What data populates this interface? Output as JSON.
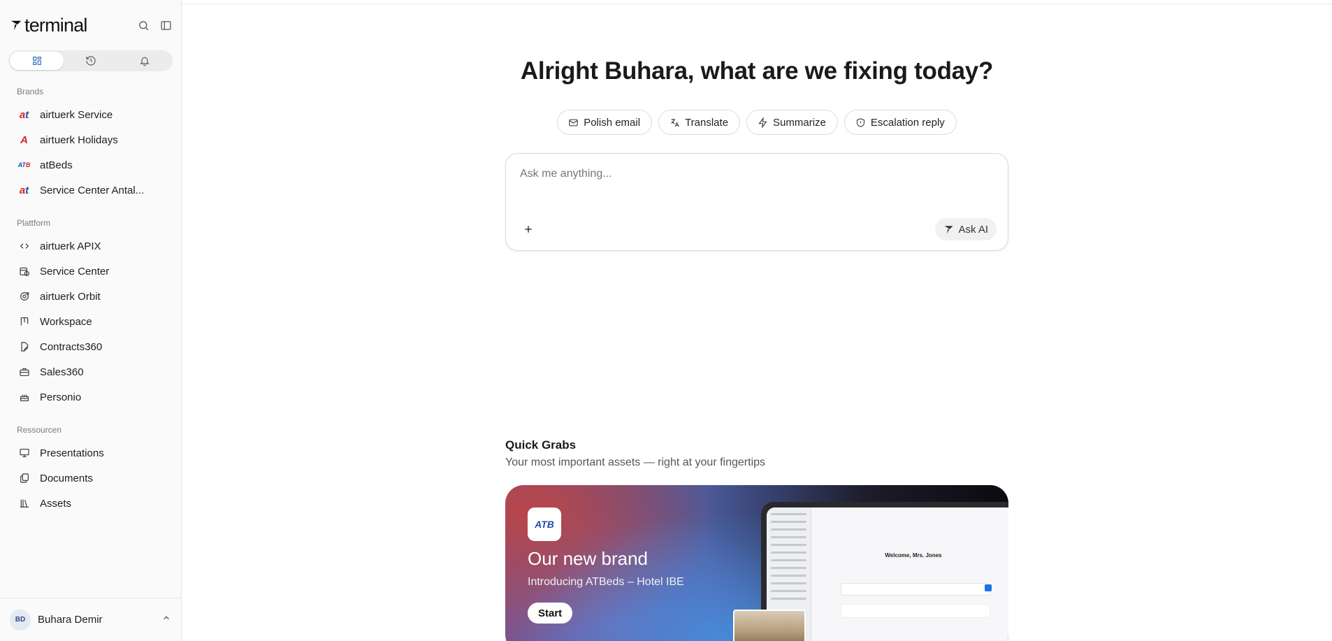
{
  "app": {
    "logo_text": "terminal",
    "search_icon": "search-icon",
    "sidebar_toggle_icon": "panel-left-icon"
  },
  "segmented": [
    {
      "icon": "grid-icon",
      "active": true
    },
    {
      "icon": "history-icon",
      "active": false
    },
    {
      "icon": "bell-icon",
      "active": false
    }
  ],
  "sidebar": {
    "sections": [
      {
        "label": "Brands",
        "items": [
          {
            "label": "airtuerk Service",
            "icon": "airtuerk-logo"
          },
          {
            "label": "airtuerk Holidays",
            "icon": "airtuerk-holidays-logo"
          },
          {
            "label": "atBeds",
            "icon": "atbeds-logo"
          },
          {
            "label": "Service Center Antal...",
            "icon": "airtuerk-logo"
          }
        ]
      },
      {
        "label": "Plattform",
        "items": [
          {
            "label": "airtuerk APIX",
            "icon": "code-icon"
          },
          {
            "label": "Service Center",
            "icon": "calendar-clock-icon"
          },
          {
            "label": "airtuerk Orbit",
            "icon": "orbit-icon"
          },
          {
            "label": "Workspace",
            "icon": "kanban-icon"
          },
          {
            "label": "Contracts360",
            "icon": "file-edit-icon"
          },
          {
            "label": "Sales360",
            "icon": "briefcase-icon"
          },
          {
            "label": "Personio",
            "icon": "cake-icon"
          }
        ]
      },
      {
        "label": "Ressourcen",
        "items": [
          {
            "label": "Presentations",
            "icon": "presentation-icon"
          },
          {
            "label": "Documents",
            "icon": "copy-file-icon"
          },
          {
            "label": "Assets",
            "icon": "library-icon"
          }
        ]
      }
    ]
  },
  "user": {
    "initials": "BD",
    "name": "Buhara Demir"
  },
  "main": {
    "headline": "Alright Buhara, what are we fixing today?",
    "chips": [
      {
        "label": "Polish email",
        "icon": "mail-icon"
      },
      {
        "label": "Translate",
        "icon": "translate-icon"
      },
      {
        "label": "Summarize",
        "icon": "zap-icon"
      },
      {
        "label": "Escalation reply",
        "icon": "shield-icon"
      }
    ],
    "ask": {
      "placeholder": "Ask me anything...",
      "button_label": "Ask AI"
    },
    "quick_grabs": {
      "title": "Quick Grabs",
      "subtitle": "Your most important assets — right at your fingertips"
    },
    "promo": {
      "logo_text": "ATB",
      "title": "Our new brand",
      "subtitle": "Introducing ATBeds – Hotel IBE",
      "button_label": "Start",
      "preview_heading": "Welcome, Mrs. Jones"
    }
  }
}
